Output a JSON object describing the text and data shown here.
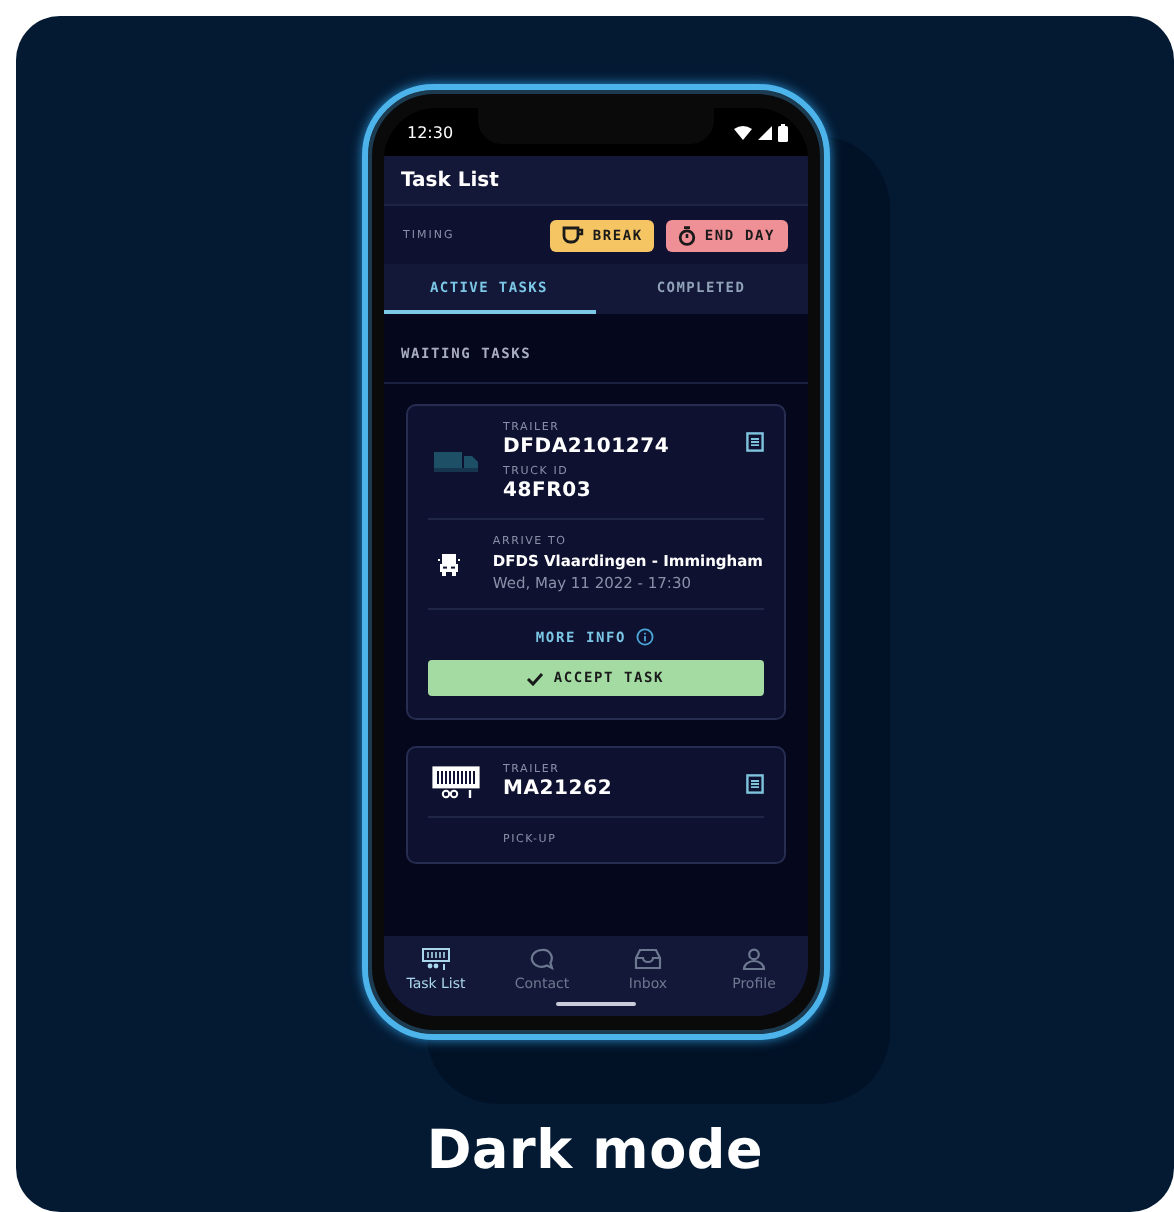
{
  "status_bar": {
    "time": "12:30"
  },
  "header": {
    "title": "Task List"
  },
  "timing": {
    "label": "TIMING",
    "buttons": [
      {
        "kind": "break",
        "label": "BREAK"
      },
      {
        "kind": "end_day",
        "label": "END DAY"
      }
    ]
  },
  "tabs": [
    {
      "label": "ACTIVE TASKS",
      "selected": true
    },
    {
      "label": "COMPLETED",
      "selected": false
    }
  ],
  "section": {
    "title": "WAITING TASKS"
  },
  "tasks": [
    {
      "kind": "truck",
      "fields": [
        {
          "label": "TRAILER",
          "value": "DFDA2101274"
        },
        {
          "label": "TRUCK ID",
          "value": "48FR03"
        }
      ],
      "stop": {
        "label": "ARRIVE TO",
        "place": "DFDS Vlaardingen - Immingham",
        "time": "Wed, May 11 2022 - 17:30"
      },
      "more_info": "MORE INFO",
      "action": "ACCEPT TASK"
    },
    {
      "kind": "trailer",
      "fields": [
        {
          "label": "TRAILER",
          "value": "MA21262"
        }
      ],
      "stop": {
        "label": "PICK-UP"
      }
    }
  ],
  "nav": [
    {
      "label": "Task List",
      "selected": true
    },
    {
      "label": "Contact",
      "selected": false
    },
    {
      "label": "Inbox",
      "selected": false
    },
    {
      "label": "Profile",
      "selected": false
    }
  ],
  "caption": "Dark mode"
}
